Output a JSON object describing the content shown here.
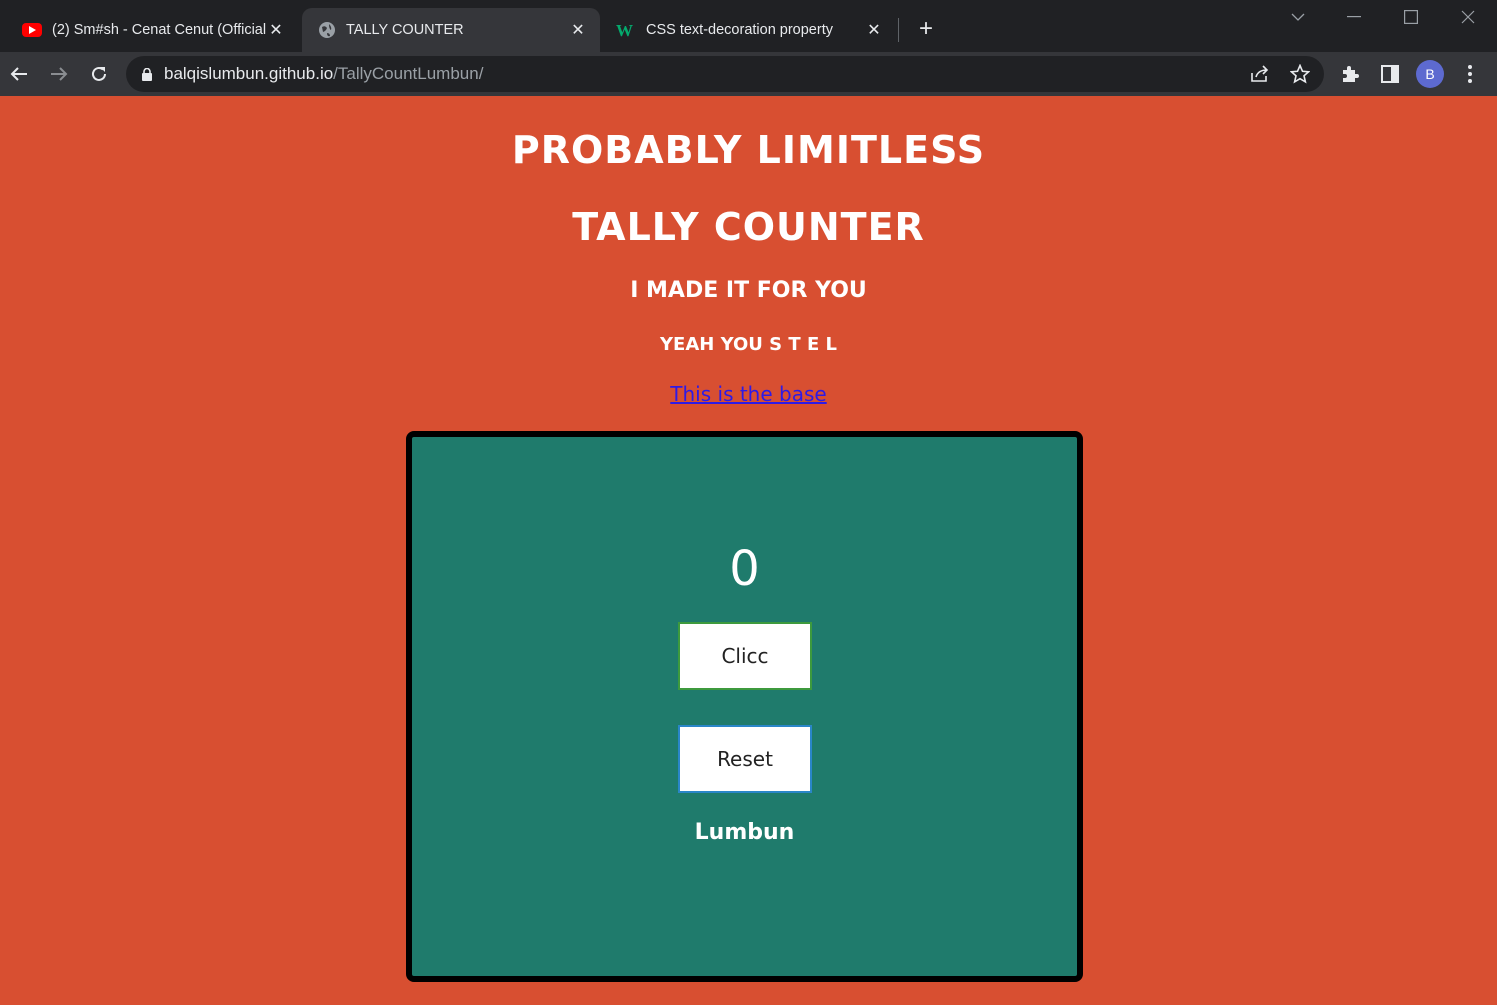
{
  "browser": {
    "tabs": [
      {
        "title": "(2) Sm#sh - Cenat Cenut (Official",
        "icon": "youtube-icon",
        "active": false
      },
      {
        "title": "TALLY COUNTER",
        "icon": "globe-icon",
        "active": true
      },
      {
        "title": "CSS text-decoration property",
        "icon": "w3-icon",
        "active": false
      }
    ],
    "url_host": "balqislumbun.github.io",
    "url_path": "/TallyCountLumbun/",
    "avatar_letter": "B"
  },
  "page": {
    "title_line1": "PROBABLY LIMITLESS",
    "title_line2": "TALLY COUNTER",
    "subtitle": "I MADE IT FOR YOU",
    "tagline": "YEAH YOU S T E L",
    "link_text": "This is the base"
  },
  "counter": {
    "value": "0",
    "click_label": "Clicc",
    "reset_label": "Reset",
    "author": "Lumbun"
  },
  "colors": {
    "page_bg": "#d84f31",
    "card_bg": "#1f7b6c",
    "link": "#2e1ae6"
  }
}
